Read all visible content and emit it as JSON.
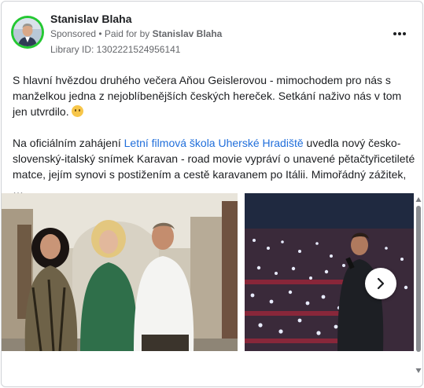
{
  "post": {
    "page_name": "Stanislav Blaha",
    "sponsored": "Sponsored",
    "paid_for_prefix": " • Paid for by ",
    "paid_for_name": "Stanislav Blaha",
    "library_id": "Library ID: 1302221524956141",
    "paragraph1": "S hlavní hvězdou druhého večera Aňou Geislerovou - mimochodem pro nás s manželkou jedna z nejoblíbenějších českých hereček. Setkání naživo nás v tom jen utvrdilo. ",
    "paragraph2_before": "Na oficiálním zahájení ",
    "paragraph2_link": "Letní filmová škola Uherské Hradiště",
    "paragraph2_after": " uvedla nový česko-slovenský-italský snímek Karavan - road movie vypráví o unavené pětačtyřicetileté matce, jejím synovi s postižením a cestě karavanem po Itálii. Mimořádný zážitek, …"
  },
  "icons": {
    "more": "more-dots-icon",
    "next": "chevron-right-icon",
    "emoji": "smiling-face-icon",
    "scroll_up": "triangle-up-icon",
    "scroll_down": "triangle-down-icon"
  },
  "colors": {
    "avatar_ring": "#24c832",
    "link": "#216fdb",
    "secondary_text": "#65676b"
  }
}
